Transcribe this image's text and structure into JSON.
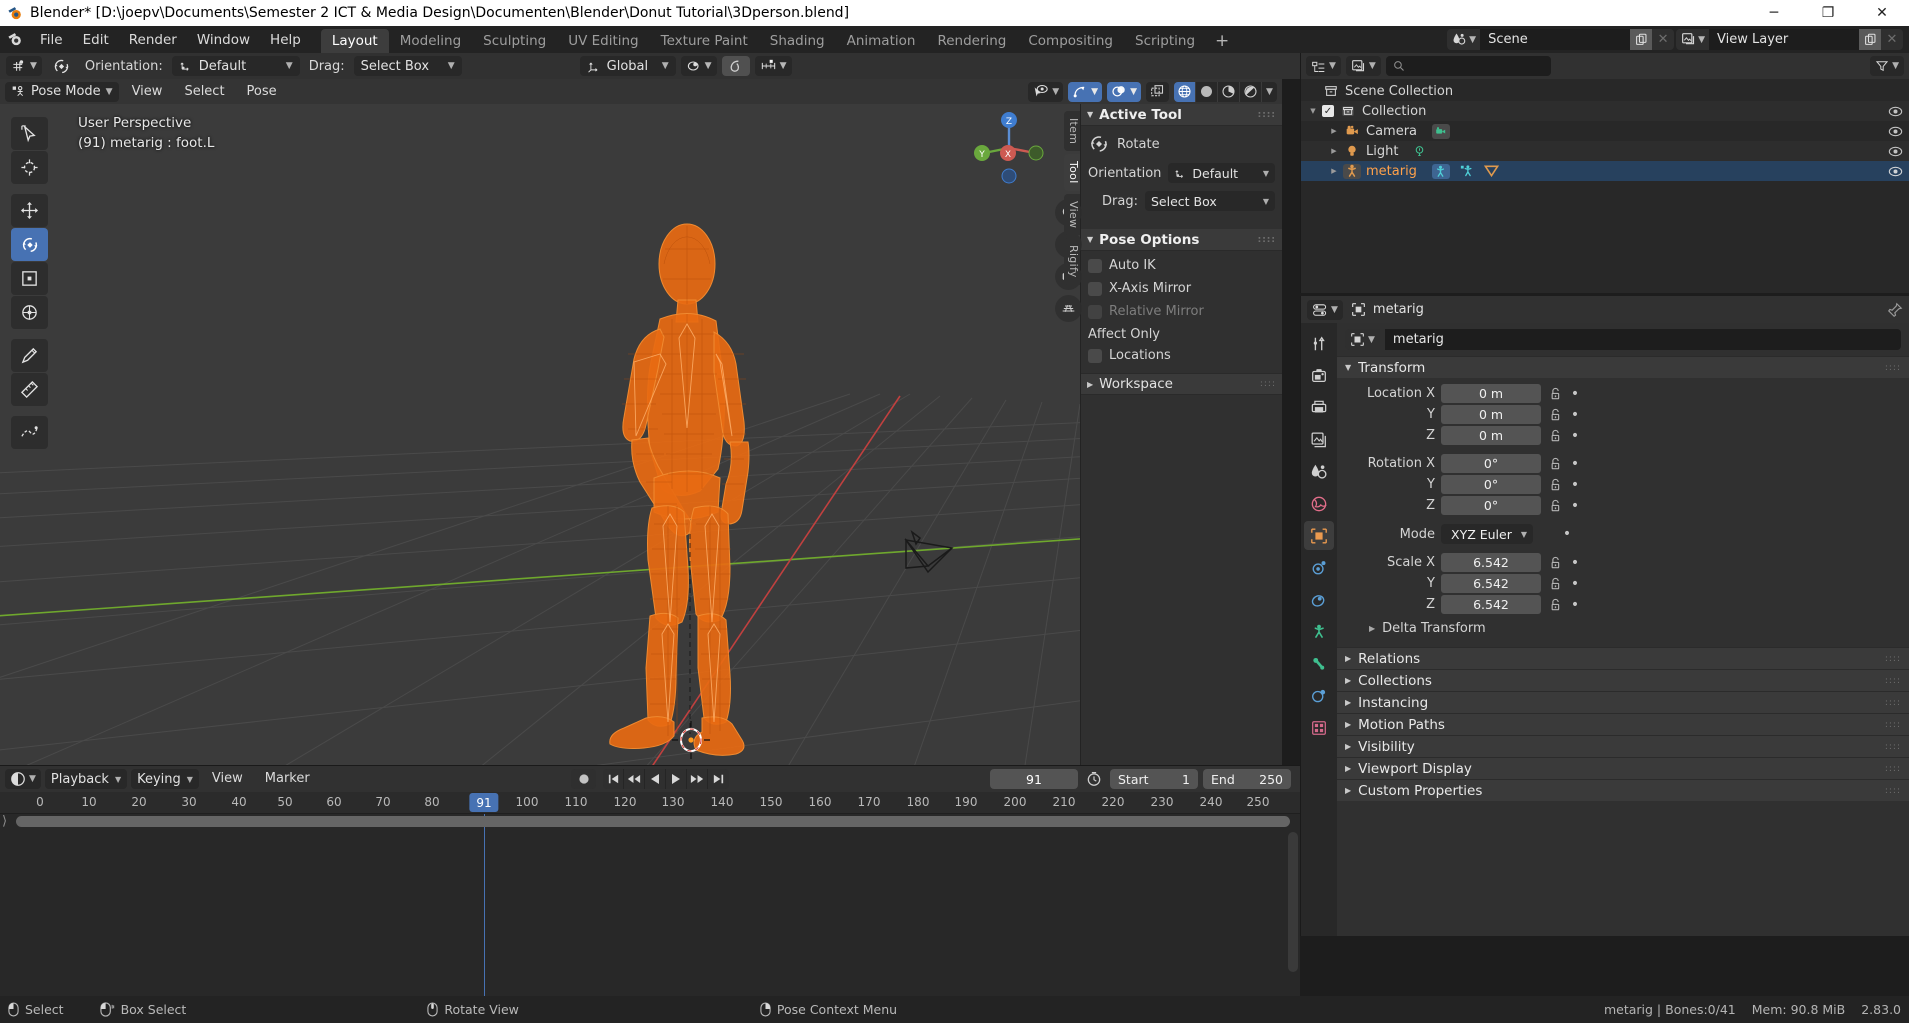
{
  "window": {
    "title": "Blender* [D:\\joepv\\Documents\\Semester 2 ICT & Media Design\\Documenten\\Blender\\Donut Tutorial\\3Dperson.blend]",
    "minimize": "─",
    "maximize": "❐",
    "close": "✕"
  },
  "topbar": {
    "menus": [
      "File",
      "Edit",
      "Render",
      "Window",
      "Help"
    ],
    "workspaces": [
      {
        "label": "Layout",
        "active": true
      },
      {
        "label": "Modeling",
        "active": false
      },
      {
        "label": "Sculpting",
        "active": false
      },
      {
        "label": "UV Editing",
        "active": false
      },
      {
        "label": "Texture Paint",
        "active": false
      },
      {
        "label": "Shading",
        "active": false
      },
      {
        "label": "Animation",
        "active": false
      },
      {
        "label": "Rendering",
        "active": false
      },
      {
        "label": "Compositing",
        "active": false
      },
      {
        "label": "Scripting",
        "active": false
      }
    ],
    "add_workspace": "+",
    "scene_name": "Scene",
    "view_layer_name": "View Layer",
    "new_scene_icon": "copy-icon",
    "unlink_scene_icon": "x-icon"
  },
  "tool_settings": {
    "orientation_label": "Orientation:",
    "orientation_value": "Default",
    "drag_label": "Drag:",
    "drag_value": "Select Box",
    "transform_orientation": "Global",
    "snap_enabled": true
  },
  "viewport": {
    "mode": "Pose Mode",
    "menus": [
      "View",
      "Select",
      "Pose"
    ],
    "overlay_text_line1": "User Perspective",
    "overlay_text_line2": "(91) metarig : foot.L",
    "shading_modes": [
      "wireframe",
      "solid",
      "material-preview",
      "rendered"
    ],
    "shading_active": "wireframe",
    "gizmo_axes": {
      "z": "Z",
      "y": "Y",
      "x": "X"
    },
    "tools": [
      {
        "name": "tweak",
        "selected": false
      },
      {
        "name": "cursor",
        "selected": false
      },
      {
        "name": "move",
        "selected": false
      },
      {
        "name": "rotate",
        "selected": true
      },
      {
        "name": "scale",
        "selected": false
      },
      {
        "name": "transform",
        "selected": false
      },
      {
        "name": "annotate",
        "selected": false
      },
      {
        "name": "measure",
        "selected": false
      },
      {
        "name": "breakdowner",
        "selected": false
      }
    ]
  },
  "npanel": {
    "tabs": [
      {
        "label": "Item",
        "active": false
      },
      {
        "label": "Tool",
        "active": true
      },
      {
        "label": "View",
        "active": false
      },
      {
        "label": "Rigify",
        "active": false
      }
    ],
    "active_tool": {
      "title": "Active Tool",
      "tool_name": "Rotate",
      "orientation_label": "Orientation",
      "orientation_value": "Default",
      "drag_label": "Drag:",
      "drag_value": "Select Box"
    },
    "pose_options": {
      "title": "Pose Options",
      "auto_ik": {
        "label": "Auto IK",
        "checked": false
      },
      "x_axis_mirror": {
        "label": "X-Axis Mirror",
        "checked": false
      },
      "relative_mirror": {
        "label": "Relative Mirror",
        "checked": false,
        "disabled": true
      },
      "affect_only_label": "Affect Only",
      "locations": {
        "label": "Locations",
        "checked": false
      }
    },
    "workspace": {
      "title": "Workspace"
    }
  },
  "outliner": {
    "search_placeholder": "",
    "rows": [
      {
        "label": "Scene Collection",
        "icon": "collection-icon",
        "depth": 0,
        "selected": false,
        "checkbox": false,
        "disclosure": "",
        "eye": false
      },
      {
        "label": "Collection",
        "icon": "collection-icon",
        "depth": 1,
        "selected": false,
        "checkbox": true,
        "disclosure": "▼",
        "eye": true
      },
      {
        "label": "Camera",
        "icon": "camera-icon",
        "depth": 2,
        "selected": false,
        "checkbox": false,
        "disclosure": "▶",
        "eye": true,
        "data_icon": "camera-data-icon"
      },
      {
        "label": "Light",
        "icon": "light-icon",
        "depth": 2,
        "selected": false,
        "checkbox": false,
        "disclosure": "▶",
        "eye": true,
        "data_icon": "light-data-icon"
      },
      {
        "label": "metarig",
        "icon": "armature-icon",
        "depth": 2,
        "selected": true,
        "checkbox": false,
        "disclosure": "▶",
        "eye": true,
        "data_icon": "armature-data-icon",
        "active": true
      }
    ]
  },
  "properties": {
    "breadcrumb_object": "metarig",
    "id_name": "metarig",
    "nav_tabs": [
      {
        "name": "tool-tab",
        "active": false
      },
      {
        "name": "render-tab",
        "active": false
      },
      {
        "name": "output-tab",
        "active": false
      },
      {
        "name": "view-layer-tab",
        "active": false
      },
      {
        "name": "scene-tab",
        "active": false
      },
      {
        "name": "world-tab",
        "active": false
      },
      {
        "name": "object-tab",
        "active": true
      },
      {
        "name": "modifier-tab",
        "active": false
      },
      {
        "name": "physics-tab",
        "active": false
      },
      {
        "name": "object-constraint-tab",
        "active": false
      },
      {
        "name": "object-data-tab",
        "active": false
      },
      {
        "name": "material-tab",
        "active": false
      },
      {
        "name": "texture-tab",
        "active": false
      }
    ],
    "transform": {
      "title": "Transform",
      "location_label": "Location X",
      "location": [
        "0 m",
        "0 m",
        "0 m"
      ],
      "rotation_label": "Rotation X",
      "rotation": [
        "0°",
        "0°",
        "0°"
      ],
      "mode_label": "Mode",
      "mode_value": "XYZ Euler",
      "scale_label": "Scale X",
      "scale": [
        "6.542",
        "6.542",
        "6.542"
      ],
      "axis_y": "Y",
      "axis_z": "Z",
      "delta_transform": "Delta Transform"
    },
    "sections": [
      "Relations",
      "Collections",
      "Instancing",
      "Motion Paths",
      "Visibility",
      "Viewport Display",
      "Custom Properties"
    ]
  },
  "timeline": {
    "editor_type": "timeline-icon",
    "dropdowns": [
      "Playback",
      "Keying"
    ],
    "menus": [
      "View",
      "Marker"
    ],
    "transport": [
      "record",
      "jump-to-start",
      "prev-keyframe",
      "play-reverse",
      "play",
      "next-keyframe",
      "jump-to-end"
    ],
    "current_frame": "91",
    "start_label": "Start",
    "start_value": "1",
    "end_label": "End",
    "end_value": "250",
    "ruler_ticks": [
      "0",
      "10",
      "20",
      "30",
      "40",
      "50",
      "60",
      "70",
      "80",
      "100",
      "110",
      "120",
      "130",
      "140",
      "150",
      "160",
      "170",
      "180",
      "190",
      "200",
      "210",
      "220",
      "230",
      "240",
      "250"
    ],
    "playhead_frame": "91"
  },
  "statusbar": {
    "hints": [
      {
        "icon": "mouse-left-icon",
        "label": "Select"
      },
      {
        "icon": "mouse-left-drag-icon",
        "label": "Box Select"
      },
      {
        "icon": "mouse-middle-icon",
        "label": "Rotate View"
      },
      {
        "icon": "mouse-right-icon",
        "label": "Pose Context Menu"
      }
    ],
    "right": [
      "metarig | Bones:0/41",
      "Mem: 90.8 MiB",
      "2.83.0"
    ]
  },
  "colors": {
    "accent_blue": "#4772b3",
    "armature_orange": "#ea6a16",
    "selected_row": "#27415e",
    "active_object_text": "#ffa14a",
    "panel_bg": "#303030",
    "viewport_bg": "#3b3b3b"
  }
}
